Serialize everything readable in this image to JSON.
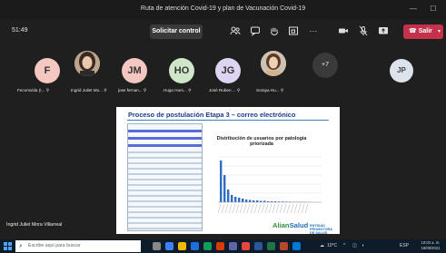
{
  "window": {
    "title": "Ruta de atención Covid-19 y plan de Vacunación Covid-19"
  },
  "toolbar": {
    "timer": "51:49",
    "control_label": "Solicitar control",
    "leave_label": "Salir",
    "icons": [
      "people-icon",
      "chat-icon",
      "reactions-icon",
      "rooms-icon",
      "more-icon",
      "camera-icon",
      "mic-off-icon",
      "share-icon",
      "phone-icon"
    ]
  },
  "participants": [
    {
      "initials": "F",
      "name": "Fecomvida (I...",
      "color": "#f4c7c0"
    },
    {
      "initials": "",
      "name": "Ingrid Juliet Mo...",
      "photo": true
    },
    {
      "initials": "JM",
      "name": "jose fernan...",
      "color": "#f4c7c0"
    },
    {
      "initials": "HO",
      "name": "Hugo Hum...",
      "color": "#cfe6c8"
    },
    {
      "initials": "JG",
      "name": "José Ruben ...",
      "color": "#dcd4f0"
    },
    {
      "initials": "",
      "name": "Soraya Hu...",
      "photo": true
    }
  ],
  "overflow_count": "+7",
  "self_initials": "JP",
  "slide": {
    "title": "Proceso de postulación Etapa 3 – correo electrónico",
    "chart_title": "Distribución de usuarios por patología priorizada",
    "logo_text_main": "Alian",
    "logo_text_accent": "Salud",
    "logo_secondary": "ENTIDAD PROMOTORA DE SALUD"
  },
  "presenter_name": "Ingrid Juliet Mora Villarreal",
  "taskbar": {
    "search_placeholder": "Escribe aquí para buscar",
    "temperature": "10°C",
    "language": "ESP",
    "time": "10:02 a. m.",
    "date": "16/09/2021"
  }
}
